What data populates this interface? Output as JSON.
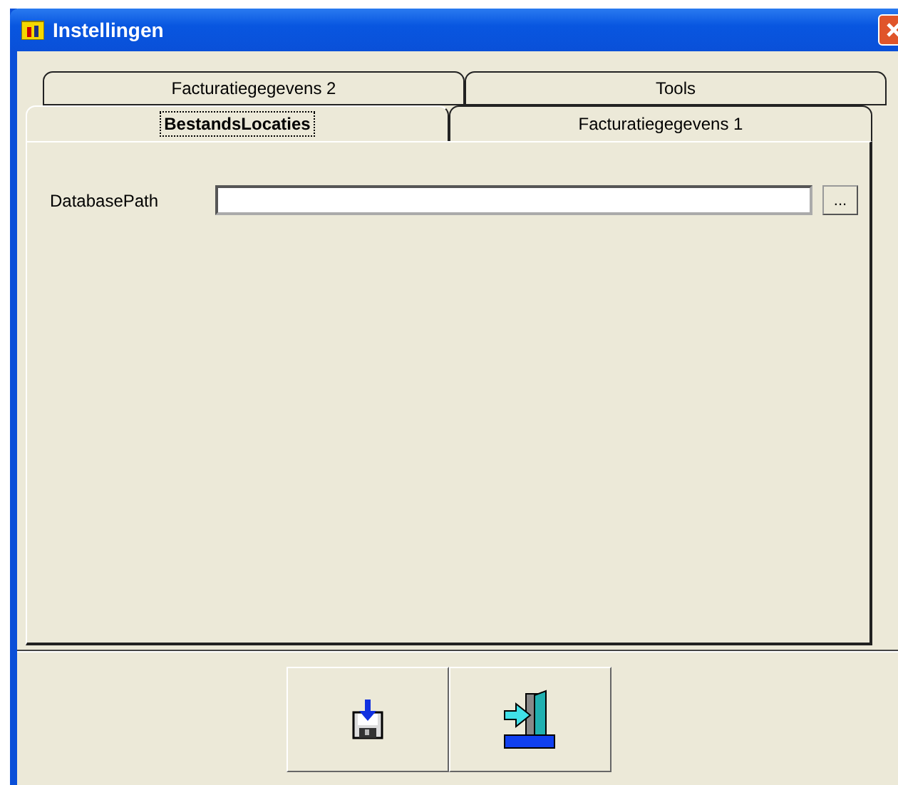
{
  "window": {
    "title": "Instellingen"
  },
  "tab_rows": [
    [
      {
        "label": "Facturatiegegevens 2",
        "selected": false
      },
      {
        "label": "Tools",
        "selected": false
      }
    ],
    [
      {
        "label": "BestandsLocaties",
        "selected": true
      },
      {
        "label": "Facturatiegegevens 1",
        "selected": false
      }
    ]
  ],
  "fields": [
    {
      "label": "DatabasePath",
      "browse": "..."
    }
  ]
}
